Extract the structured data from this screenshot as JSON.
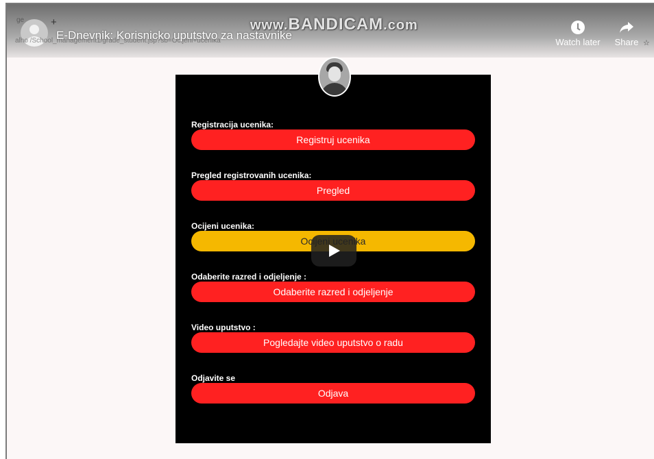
{
  "video": {
    "title": "E-Dnevnik: Korisnicko uputstvo za nastavnike",
    "watermark_prefix": "www.",
    "watermark_main": "BANDICAM",
    "watermark_suffix": ".com",
    "watch_later_label": "Watch later",
    "share_label": "Share",
    "url_ghost": "alho    /School_management1/grade_student.jsp?sb=Ocijeni+ucenika",
    "tab_ghost": "ge"
  },
  "sections": [
    {
      "label": "Registracija ucenika:",
      "button": "Registruj ucenika",
      "active": false
    },
    {
      "label": "Pregled registrovanih ucenika:",
      "button": "Pregled",
      "active": false
    },
    {
      "label": "Ocijeni ucenika:",
      "button": "Ocijeni ucenika",
      "active": true
    },
    {
      "label": "Odaberite razred i odjeljenje :",
      "button": "Odaberite razred i odjeljenje",
      "active": false
    },
    {
      "label": "Video uputstvo :",
      "button": "Pogledajte video uputstvo o radu",
      "active": false
    },
    {
      "label": "Odjavite se",
      "button": "Odjava",
      "active": false
    }
  ],
  "colors": {
    "button_default": "#ff2121",
    "button_active": "#f5b800",
    "panel_bg": "#000000"
  }
}
